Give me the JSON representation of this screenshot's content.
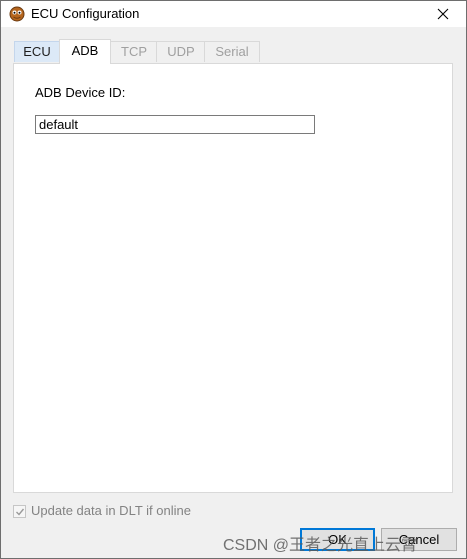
{
  "window": {
    "title": "ECU Configuration",
    "app_icon": "ecu-app-icon",
    "close_icon": "close-icon"
  },
  "tabs": [
    {
      "label": "ECU",
      "state": "highlighted"
    },
    {
      "label": "ADB",
      "state": "selected"
    },
    {
      "label": "TCP",
      "state": "disabled"
    },
    {
      "label": "UDP",
      "state": "disabled"
    },
    {
      "label": "Serial",
      "state": "disabled"
    }
  ],
  "adb_panel": {
    "device_id_label": "ADB Device ID:",
    "device_id_value": "default"
  },
  "footer": {
    "update_checkbox_label": "Update data in DLT if online",
    "update_checkbox_checked": true,
    "ok_label": "OK",
    "cancel_label": "Cancel"
  },
  "watermark": {
    "text": "CSDN @王者之光直上云霄"
  },
  "colors": {
    "accent": "#0078d7",
    "selected_tab_bg": "#ffffff",
    "highlighted_tab_bg": "#dce9f7",
    "disabled_text": "#a0a0a0"
  }
}
